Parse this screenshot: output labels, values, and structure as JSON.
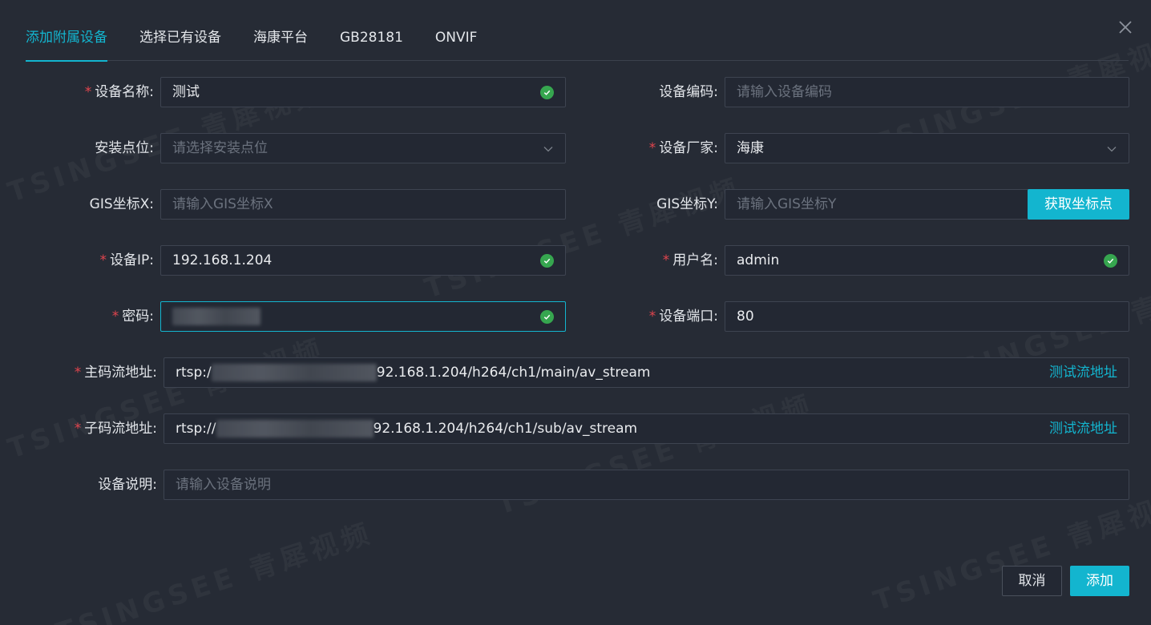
{
  "tabs": [
    {
      "label": "添加附属设备",
      "active": true
    },
    {
      "label": "选择已有设备"
    },
    {
      "label": "海康平台"
    },
    {
      "label": "GB28181"
    },
    {
      "label": "ONVIF"
    }
  ],
  "form": {
    "device_name": {
      "label": "设备名称:",
      "value": "测试"
    },
    "device_code": {
      "label": "设备编码:",
      "placeholder": "请输入设备编码"
    },
    "install_point": {
      "label": "安装点位:",
      "placeholder": "请选择安装点位"
    },
    "manufacturer": {
      "label": "设备厂家:",
      "value": "海康"
    },
    "gis_x": {
      "label": "GIS坐标X:",
      "placeholder": "请输入GIS坐标X"
    },
    "gis_y": {
      "label": "GIS坐标Y:",
      "placeholder": "请输入GIS坐标Y"
    },
    "get_coords_label": "获取坐标点",
    "device_ip": {
      "label": "设备IP:",
      "value": "192.168.1.204"
    },
    "username": {
      "label": "用户名:",
      "value": "admin"
    },
    "password": {
      "label": "密码:"
    },
    "device_port": {
      "label": "设备端口:",
      "value": "80"
    },
    "main_stream": {
      "label": "主码流地址:",
      "prefix": "rtsp:/",
      "suffix": "92.168.1.204/h264/ch1/main/av_stream",
      "test_label": "测试流地址"
    },
    "sub_stream": {
      "label": "子码流地址:",
      "prefix": "rtsp://",
      "suffix": "92.168.1.204/h264/ch1/sub/av_stream",
      "test_label": "测试流地址"
    },
    "description": {
      "label": "设备说明:",
      "placeholder": "请输入设备说明"
    }
  },
  "footer": {
    "cancel_label": "取消",
    "add_label": "添加"
  },
  "watermark": "TSINGSEE 青犀视频",
  "colors": {
    "accent": "#13b5cf",
    "required": "#e2454e",
    "valid": "#36a64f",
    "background": "#262b35"
  }
}
